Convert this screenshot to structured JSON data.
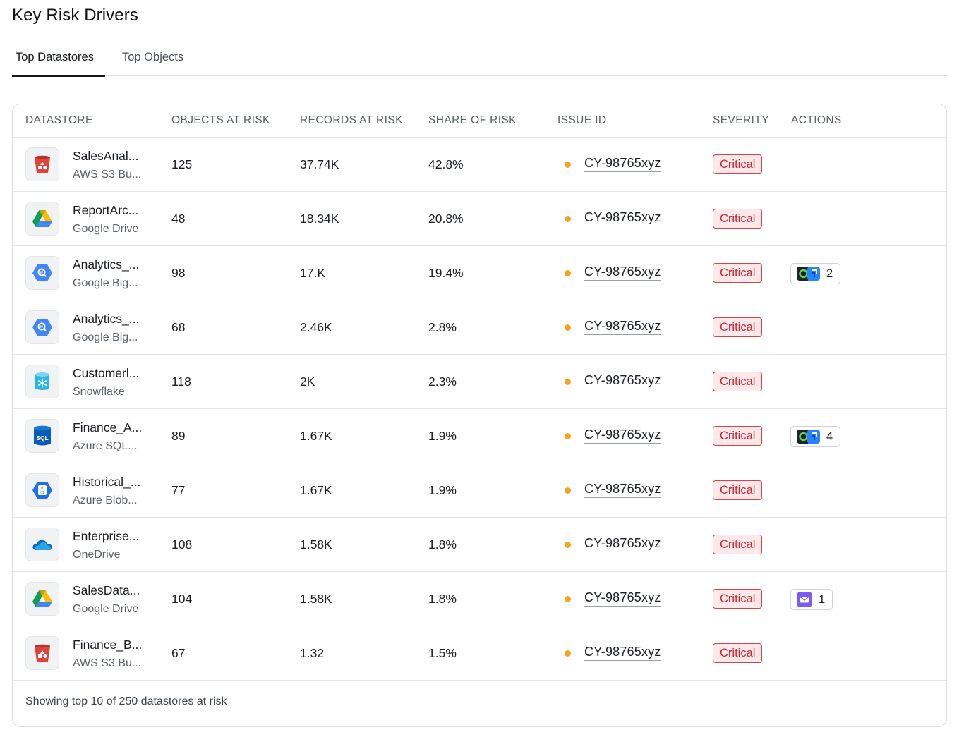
{
  "header": {
    "title": "Key Risk Drivers"
  },
  "tabs": [
    {
      "label": "Top Datastores",
      "active": true
    },
    {
      "label": "Top Objects",
      "active": false
    }
  ],
  "table": {
    "columns": [
      "DATASTORE",
      "OBJECTS AT RISK",
      "RECORDS AT RISK",
      "SHARE OF RISK",
      "ISSUE ID",
      "SEVERITY",
      "ACTIONS"
    ],
    "rows": [
      {
        "icon": "aws-s3-bucket-icon",
        "name": "SalesAnal...",
        "type": "AWS S3 Bu...",
        "objects": "125",
        "records": "37.74K",
        "share": "42.8%",
        "issue_id": "CY-98765xyz",
        "severity": "Critical",
        "action": null
      },
      {
        "icon": "google-drive-icon",
        "name": "ReportArc...",
        "type": "Google Drive",
        "objects": "48",
        "records": "18.34K",
        "share": "20.8%",
        "issue_id": "CY-98765xyz",
        "severity": "Critical",
        "action": null
      },
      {
        "icon": "google-bigquery-icon",
        "name": "Analytics_...",
        "type": "Google Big...",
        "objects": "98",
        "records": "17.K",
        "share": "19.4%",
        "issue_id": "CY-98765xyz",
        "severity": "Critical",
        "action": {
          "icon": "jira-servicenow-icon",
          "count": "2"
        }
      },
      {
        "icon": "google-bigquery-icon",
        "name": "Analytics_...",
        "type": "Google Big...",
        "objects": "68",
        "records": "2.46K",
        "share": "2.8%",
        "issue_id": "CY-98765xyz",
        "severity": "Critical",
        "action": null
      },
      {
        "icon": "snowflake-icon",
        "name": "Customerl...",
        "type": "Snowflake",
        "objects": "118",
        "records": "2K",
        "share": "2.3%",
        "issue_id": "CY-98765xyz",
        "severity": "Critical",
        "action": null
      },
      {
        "icon": "azure-sql-icon",
        "name": "Finance_A...",
        "type": "Azure SQL...",
        "objects": "89",
        "records": "1.67K",
        "share": "1.9%",
        "issue_id": "CY-98765xyz",
        "severity": "Critical",
        "action": {
          "icon": "jira-servicenow-icon",
          "count": "4"
        }
      },
      {
        "icon": "azure-blob-icon",
        "name": "Historical_...",
        "type": "Azure Blob...",
        "objects": "77",
        "records": "1.67K",
        "share": "1.9%",
        "issue_id": "CY-98765xyz",
        "severity": "Critical",
        "action": null
      },
      {
        "icon": "onedrive-icon",
        "name": "Enterprise...",
        "type": "OneDrive",
        "objects": "108",
        "records": "1.58K",
        "share": "1.8%",
        "issue_id": "CY-98765xyz",
        "severity": "Critical",
        "action": null
      },
      {
        "icon": "google-drive-icon",
        "name": "SalesData...",
        "type": "Google Drive",
        "objects": "104",
        "records": "1.58K",
        "share": "1.8%",
        "issue_id": "CY-98765xyz",
        "severity": "Critical",
        "action": {
          "icon": "email-icon",
          "count": "1"
        }
      },
      {
        "icon": "aws-s3-bucket-icon",
        "name": "Finance_B...",
        "type": "AWS S3 Bu...",
        "objects": "67",
        "records": "1.32",
        "share": "1.5%",
        "issue_id": "CY-98765xyz",
        "severity": "Critical",
        "action": null
      }
    ]
  },
  "footer": {
    "text": "Showing top 10 of 250 datastores at risk"
  },
  "colors": {
    "severity_critical": "#c8262f",
    "severity_bg": "#fde9ea",
    "status_dot": "#f5a41c"
  }
}
